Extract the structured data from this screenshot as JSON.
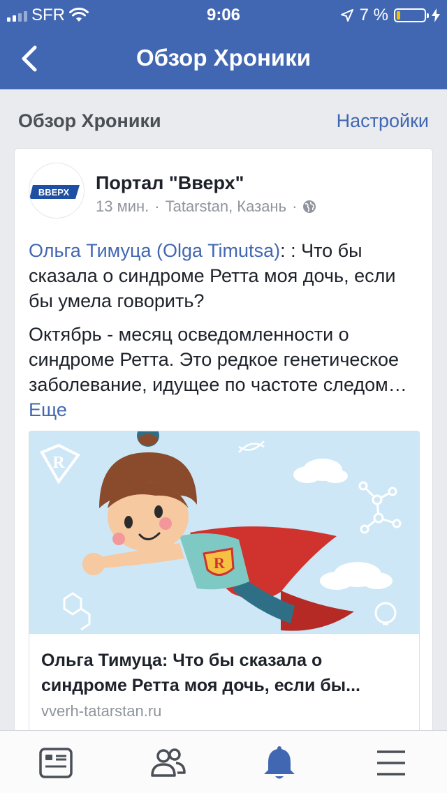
{
  "status_bar": {
    "carrier": "SFR",
    "time": "9:06",
    "battery_percent": "7 %",
    "battery_level": 0.07
  },
  "nav": {
    "title": "Обзор Хроники"
  },
  "section": {
    "title": "Обзор Хроники",
    "settings_label": "Настройки"
  },
  "post": {
    "author": "Портал \"Вверх\"",
    "avatar_logo_text": "ВВЕРХ",
    "time": "13 мин.",
    "separator": "·",
    "location": "Tatarstan, Казань",
    "text_link": "Ольга Тимуца (Olga Timutsa)",
    "text_rest": ": : Что бы сказала о синдроме Ретта моя дочь, если бы умела говорить?",
    "body": "Октябрь - месяц осведомленности о синдроме Ретта. Это редкое генетическое заболевание, идущее по частоте следом…",
    "more_label": "Еще",
    "attachment": {
      "title": "Ольга Тимуца: Что бы сказала о синдроме Ретта моя дочь, если бы...",
      "domain": "vverh-tatarstan.ru",
      "emblem_letter": "R"
    }
  },
  "tabs": [
    {
      "icon": "news-feed-icon",
      "active": false
    },
    {
      "icon": "friends-icon",
      "active": false
    },
    {
      "icon": "notifications-bell-icon",
      "active": true
    },
    {
      "icon": "menu-icon",
      "active": false
    }
  ],
  "colors": {
    "brand": "#4267b2",
    "background": "#e9ebee",
    "meta_text": "#90949c",
    "battery_low": "#f5c000"
  }
}
